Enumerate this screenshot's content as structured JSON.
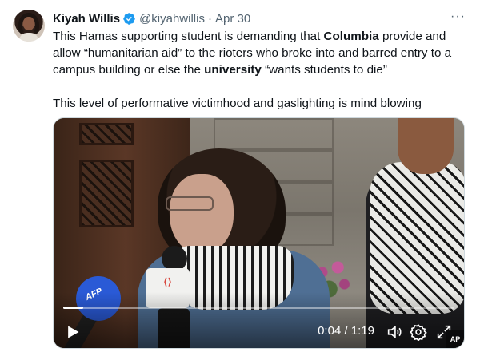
{
  "tweet": {
    "author_name": "Kiyah Willis",
    "handle": "@kiyahwillis",
    "separator": "·",
    "date": "Apr 30",
    "more_label": "···",
    "text": {
      "p1_a": "This Hamas supporting student is demanding that ",
      "p1_b": "Columbia",
      "p1_c": " provide and allow “humanitarian aid” to the rioters who broke into and barred entry to a campus building or else the ",
      "p1_d": "university",
      "p1_e": " “wants students to die”",
      "p2": "This level of performative victimhood and gaslighting is mind blowing"
    }
  },
  "video": {
    "current_time": "0:04",
    "duration": "1:19",
    "time_display": "0:04 / 1:19",
    "progress_fraction": 0.051,
    "mic_label": "AFP",
    "watermark": "AP"
  },
  "icons": {
    "verified": "verified-badge-icon",
    "more": "more-icon",
    "play": "play-icon",
    "volume": "volume-icon",
    "settings": "settings-gear-icon",
    "fullscreen": "fullscreen-icon"
  },
  "colors": {
    "text_primary": "#0f1419",
    "text_secondary": "#536471",
    "verified_blue": "#1d9bf0",
    "progress": "#ffffff"
  }
}
